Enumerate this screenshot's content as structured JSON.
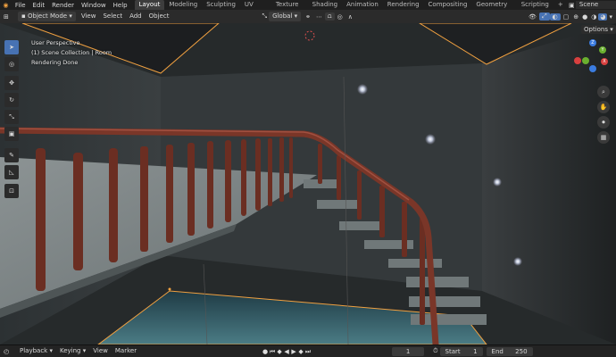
{
  "menu": [
    "File",
    "Edit",
    "Render",
    "Window",
    "Help"
  ],
  "workspaces": [
    "Layout",
    "Modeling",
    "Sculpting",
    "UV Editing",
    "Texture Paint",
    "Shading",
    "Animation",
    "Rendering",
    "Compositing",
    "Geometry Nodes",
    "Scripting"
  ],
  "workspace_add": "+",
  "scene_name": "Scene",
  "header": {
    "mode": "Object Mode",
    "view": "View",
    "select": "Select",
    "add": "Add",
    "object": "Object",
    "orientation": "Global",
    "options": "Options"
  },
  "viewport": {
    "perspective": "User Perspective",
    "collection": "(1) Scene Collection | Room",
    "status": "Rendering Done"
  },
  "gizmo": {
    "z": "Z",
    "y": "Y",
    "x": "X"
  },
  "timeline": {
    "playback": "Playback",
    "keying": "Keying",
    "view": "View",
    "marker": "Marker",
    "current_frame": "1",
    "start_label": "Start",
    "start_value": "1",
    "end_label": "End",
    "end_value": "250"
  },
  "colors": {
    "accent": "#4772b3",
    "selection": "#f0a040",
    "background": "#1d1d1d"
  }
}
